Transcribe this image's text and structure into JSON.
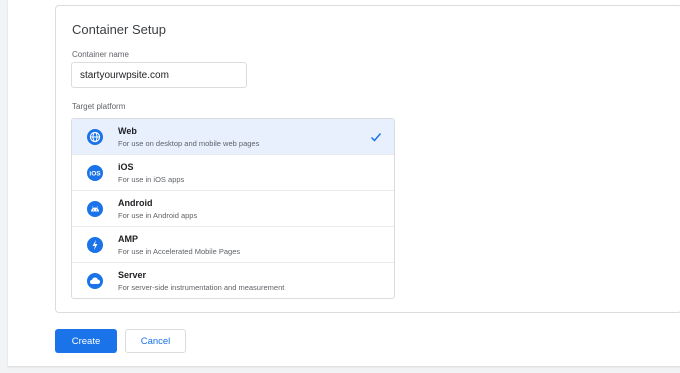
{
  "card": {
    "title": "Container Setup",
    "container_name_label": "Container name",
    "container_name_value": "startyourwpsite.com",
    "target_platform_label": "Target platform"
  },
  "platforms": [
    {
      "title": "Web",
      "description": "For use on desktop and mobile web pages",
      "icon": "globe-icon",
      "selected": true
    },
    {
      "title": "iOS",
      "description": "For use in iOS apps",
      "icon": "ios-icon",
      "selected": false
    },
    {
      "title": "Android",
      "description": "For use in Android apps",
      "icon": "android-icon",
      "selected": false
    },
    {
      "title": "AMP",
      "description": "For use in Accelerated Mobile Pages",
      "icon": "bolt-icon",
      "selected": false
    },
    {
      "title": "Server",
      "description": "For server-side instrumentation and measurement",
      "icon": "cloud-icon",
      "selected": false
    }
  ],
  "actions": {
    "create_label": "Create",
    "cancel_label": "Cancel"
  },
  "colors": {
    "accent": "#1a73e8",
    "selected_row": "#e8f0fe"
  }
}
